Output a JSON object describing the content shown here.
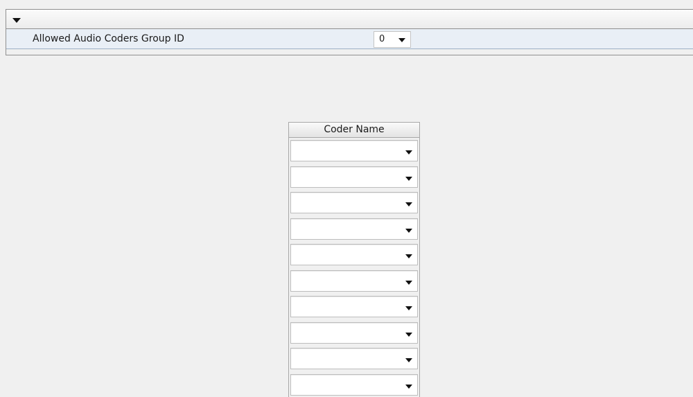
{
  "panel": {
    "toggle_icon": "caret-down-icon",
    "collapsed": false
  },
  "group_param": {
    "label": "Allowed Audio Coders Group ID",
    "value": "0",
    "icon": "caret-down-icon"
  },
  "coder_table": {
    "header": "Coder Name",
    "rows": [
      "",
      "",
      "",
      "",
      "",
      "",
      "",
      "",
      "",
      ""
    ],
    "row_icon": "caret-down-icon"
  },
  "colors": {
    "page_background": "#f0f0f0",
    "row_highlight": "#e9eff6",
    "border": "#8f8f8f"
  }
}
